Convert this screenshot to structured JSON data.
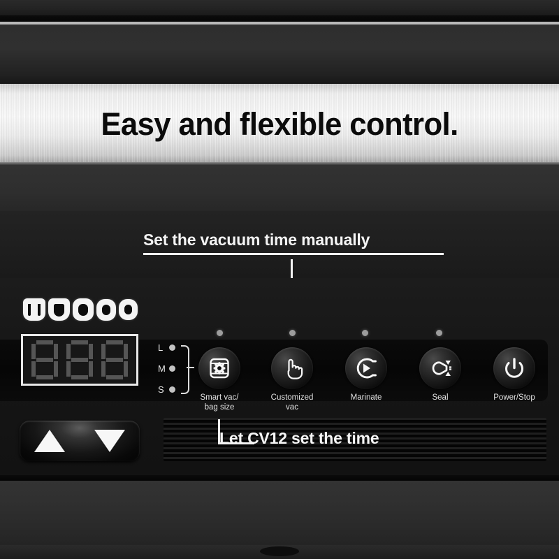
{
  "headline": "Easy and flexible control.",
  "callouts": {
    "top": "Set the vacuum time manually",
    "bottom": "Let CV12 set the time"
  },
  "display": {
    "segments": "888",
    "strength_indicator_count": 5,
    "strength_glyphs": [
      "vacuum-level-1",
      "vacuum-level-2",
      "vacuum-level-3",
      "vacuum-level-4",
      "vacuum-level-5"
    ]
  },
  "bag_size": {
    "options": [
      "L",
      "M",
      "S"
    ],
    "selected": "M"
  },
  "buttons": [
    {
      "label": "Smart vac/\nbag size",
      "icon": "bag-gear-icon",
      "led": true
    },
    {
      "label": "Customized\nvac",
      "icon": "pointing-hand-icon",
      "led": true
    },
    {
      "label": "Marinate",
      "icon": "marinate-play-icon",
      "led": true
    },
    {
      "label": "Seal",
      "icon": "seal-bag-icon",
      "led": true
    },
    {
      "label": "Power/Stop",
      "icon": "power-icon",
      "led": false
    }
  ],
  "rocker": {
    "up_label": "▲",
    "down_label": "▼"
  },
  "colors": {
    "metal_light": "#fbfbfb",
    "panel_dark": "#0a0a0a",
    "text_light": "#f4f4f4",
    "led_gray": "#9d9d9d",
    "segment_gray": "#555555"
  }
}
